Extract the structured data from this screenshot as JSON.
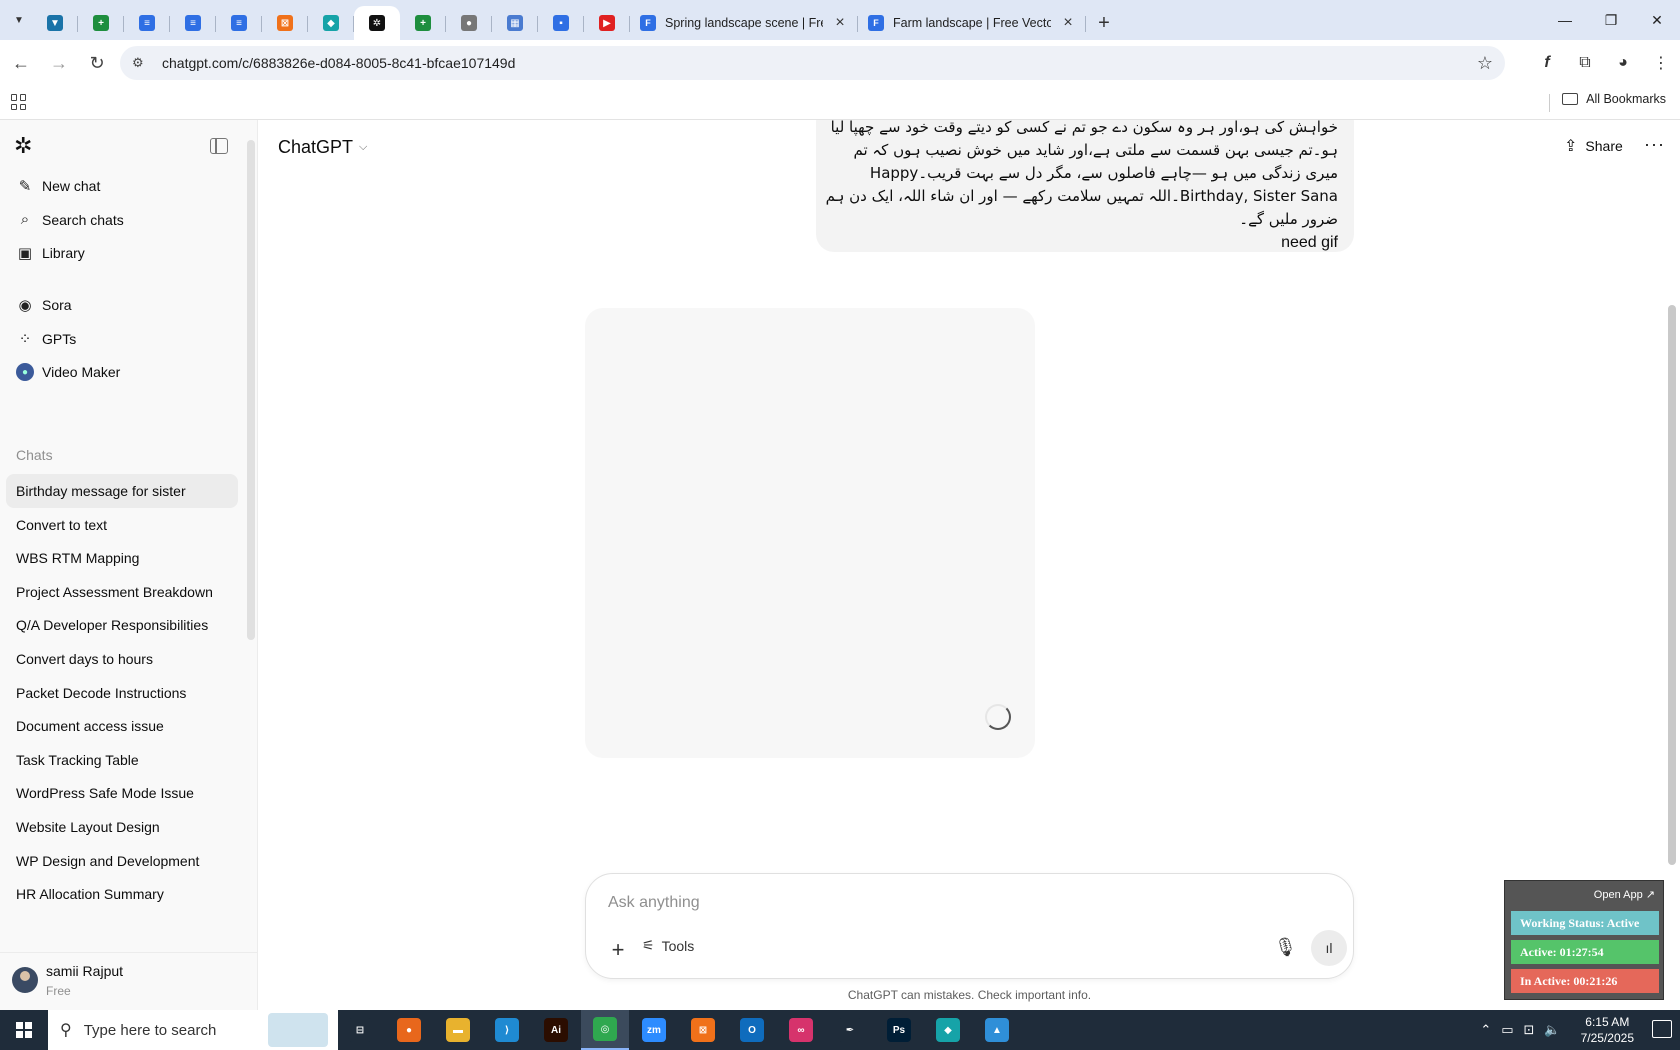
{
  "browser": {
    "pinned_tabs": [
      {
        "icon": "vpn-icon",
        "color": "#1a73a8",
        "glyph": "▼"
      },
      {
        "icon": "sheets-icon",
        "color": "#1e8e3e",
        "glyph": "+"
      },
      {
        "icon": "docs-icon",
        "color": "#2f6fe4",
        "glyph": "≡"
      },
      {
        "icon": "docs-icon",
        "color": "#2f6fe4",
        "glyph": "≡"
      },
      {
        "icon": "docs-icon",
        "color": "#2f6fe4",
        "glyph": "≡"
      },
      {
        "icon": "xampp-icon",
        "color": "#f0711a",
        "glyph": "⊠"
      },
      {
        "icon": "app-icon",
        "color": "#16a3a8",
        "glyph": "◆"
      },
      {
        "icon": "chatgpt-icon",
        "color": "#111111",
        "glyph": "✲",
        "active": true
      },
      {
        "icon": "sheets-icon",
        "color": "#1e8e3e",
        "glyph": "+"
      },
      {
        "icon": "globe-icon",
        "color": "#777777",
        "glyph": "●"
      },
      {
        "icon": "qr-icon",
        "color": "#4a7bd0",
        "glyph": "▦"
      },
      {
        "icon": "forms-icon",
        "color": "#2f6fe4",
        "glyph": "▪"
      },
      {
        "icon": "youtube-icon",
        "color": "#e02121",
        "glyph": "▶"
      }
    ],
    "tabs": [
      {
        "title": "Spring landscape scene | Free V",
        "icon": "freepik-icon"
      },
      {
        "title": "Farm landscape | Free Vector",
        "icon": "freepik-icon"
      }
    ],
    "url": "chatgpt.com/c/6883826e-d084-8005-8c41-bfcae107149d",
    "all_bookmarks": "All Bookmarks"
  },
  "sidebar": {
    "nav": [
      {
        "label": "New chat",
        "icon": "edit-icon",
        "glyph": "✎"
      },
      {
        "label": "Search chats",
        "icon": "search-icon",
        "glyph": "⌕"
      },
      {
        "label": "Library",
        "icon": "library-icon",
        "glyph": "▣"
      }
    ],
    "apps": [
      {
        "label": "Sora",
        "icon": "sora-icon",
        "glyph": "◉"
      },
      {
        "label": "GPTs",
        "icon": "gpts-icon",
        "glyph": "⁘"
      },
      {
        "label": "Video Maker",
        "icon": "video-maker-icon",
        "glyph": "●"
      }
    ],
    "chats_heading": "Chats",
    "chats": [
      "Birthday message for sister",
      "Convert to text",
      "WBS RTM Mapping",
      "Project Assessment Breakdown",
      "Q/A Developer Responsibilities",
      "Convert days to hours",
      "Packet Decode Instructions",
      "Document access issue",
      "Task Tracking Table",
      "WordPress Safe Mode Issue",
      "Website Layout Design",
      "WP Design and Development",
      "HR Allocation Summary"
    ],
    "user": {
      "name": "samii Rajput",
      "plan": "Free"
    }
  },
  "header": {
    "model": "ChatGPT",
    "share": "Share"
  },
  "conversation": {
    "user_message_lines": [
      "خواہش کی ہو،اور ہر وہ سکون دے جو تم نے کسی کو دیتے وقت خود سے چھپا لیا",
      "ہو۔تم جیسی بہن قسمت سے ملتی ہے،اور شاید میں خوش نصیب ہوں کہ تم",
      "میری زندگی میں ہو —چاہے فاصلوں سے، مگر دل سے بہت قریب۔Happy",
      "Birthday, Sister Sana۔اللہ تمہیں سلامت رکھے — اور ان شاء اللہ، ایک دن ہم",
      "ضرور ملیں گے۔"
    ],
    "user_message_tail": "need gif"
  },
  "composer": {
    "placeholder": "Ask anything",
    "tools_label": "Tools",
    "disclaimer": "ChatGPT can mistakes. Check important info."
  },
  "tracker": {
    "open_app": "Open App ↗",
    "status": "Working Status: Active",
    "active": "Active: 01:27:54",
    "inactive": "In Active: 00:21:26",
    "status_color": "#6fc3c8",
    "active_color": "#55c46a",
    "inactive_color": "#e5685a"
  },
  "taskbar": {
    "search_placeholder": "Type here to search",
    "apps": [
      {
        "icon": "task-view-icon",
        "color": "#1f2c3a",
        "glyph": "⊟"
      },
      {
        "icon": "firefox-icon",
        "color": "#e8671c",
        "glyph": "●"
      },
      {
        "icon": "file-explorer-icon",
        "color": "#e8b22e",
        "glyph": "▬"
      },
      {
        "icon": "vscode-icon",
        "color": "#1f8ad2",
        "glyph": "⟩"
      },
      {
        "icon": "illustrator-icon",
        "color": "#2b0d00",
        "glyph": "Ai"
      },
      {
        "icon": "chrome-icon",
        "color": "#2fa84f",
        "glyph": "◎",
        "active": true
      },
      {
        "icon": "zoom-icon",
        "color": "#2d8cff",
        "glyph": "zm"
      },
      {
        "icon": "xampp-icon",
        "color": "#f0711a",
        "glyph": "⊠"
      },
      {
        "icon": "outlook-icon",
        "color": "#0f6cbd",
        "glyph": "O"
      },
      {
        "icon": "creative-cloud-icon",
        "color": "#d6336c",
        "glyph": "∞"
      },
      {
        "icon": "pen-tool-icon",
        "color": "#1f2c3a",
        "glyph": "✒"
      },
      {
        "icon": "photoshop-icon",
        "color": "#001e36",
        "glyph": "Ps"
      },
      {
        "icon": "app-icon",
        "color": "#16a3a8",
        "glyph": "◆"
      },
      {
        "icon": "image-viewer-icon",
        "color": "#2f8fd8",
        "glyph": "▲"
      }
    ],
    "time": "6:15 AM",
    "date": "7/25/2025"
  }
}
